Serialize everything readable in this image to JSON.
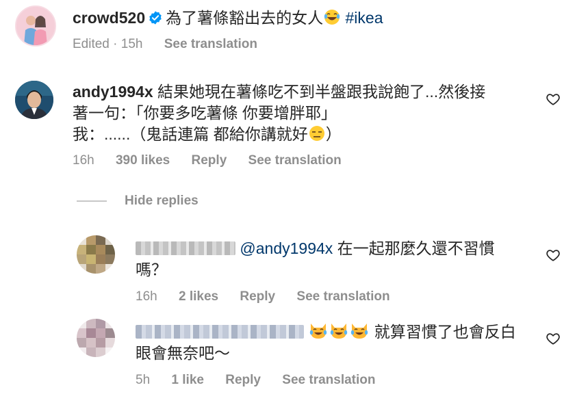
{
  "post": {
    "username": "crowd520",
    "caption": "為了薯條豁出去的女人",
    "caption_emoji": "laughing-tears-emoji",
    "hashtag": "#ikea",
    "time": "Edited · 15h",
    "see_translation": "See translation"
  },
  "comment": {
    "username": "andy1994x",
    "text_line1": "結果她現在薯條吃不到半盤跟我說飽了...然後接",
    "text_line2": "著一句：「你要多吃薯條 你要增胖耶」",
    "text_line3": "我：......（鬼話連篇 都給你講就好",
    "text_line3_end": "）",
    "emoji": "expressionless-face-emoji",
    "time": "16h",
    "likes": "390 likes",
    "reply": "Reply",
    "see_translation": "See translation"
  },
  "hide_replies": "Hide replies",
  "replies": [
    {
      "mention": "@andy1994x",
      "text_line1": "在一起那麼久還不習慣",
      "text_line2": "嗎？",
      "time": "16h",
      "likes": "2 likes",
      "reply": "Reply",
      "see_translation": "See translation"
    },
    {
      "text_line1": "就算習慣了也會反白",
      "text_line2": "眼會無奈吧～",
      "emoji": "cat-tears-of-joy-emoji",
      "time": "5h",
      "likes": "1 like",
      "reply": "Reply",
      "see_translation": "See translation"
    }
  ],
  "colors": {
    "text": "#262626",
    "secondary": "#8e8e8e",
    "link": "#00376b",
    "verified": "#0095f6"
  }
}
